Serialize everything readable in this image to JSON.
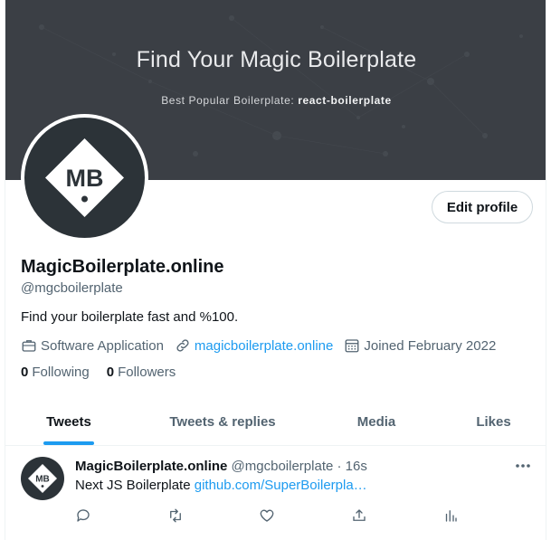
{
  "banner": {
    "title": "Find Your Magic Boilerplate",
    "subtitle_prefix": "Best Popular Boilerplate: ",
    "subtitle_bold": "react-boilerplate",
    "color": "#3b3f45"
  },
  "avatar": {
    "initials": "MB"
  },
  "profile": {
    "edit_label": "Edit profile",
    "name": "MagicBoilerplate.online",
    "handle": "@mgcboilerplate",
    "bio": "Find your boilerplate fast and %100.",
    "category": "Software Application",
    "website": "magicboilerplate.online",
    "joined": "Joined February 2022",
    "following_count": "0",
    "following_label": "Following",
    "followers_count": "0",
    "followers_label": "Followers"
  },
  "tabs": [
    {
      "label": "Tweets",
      "active": true
    },
    {
      "label": "Tweets & replies",
      "active": false
    },
    {
      "label": "Media",
      "active": false
    },
    {
      "label": "Likes",
      "active": false
    }
  ],
  "tweet": {
    "name": "MagicBoilerplate.online",
    "handle": "@mgcboilerplate",
    "separator": " · ",
    "time": "16s",
    "text": "Next JS Boilerplate ",
    "link": "github.com/SuperBoilerpla…",
    "more_icon": "more-icon",
    "actions": [
      "reply-icon",
      "retweet-icon",
      "like-icon",
      "share-icon",
      "analytics-icon"
    ]
  },
  "colors": {
    "accent": "#1d9bf0",
    "text": "#0f1419",
    "muted": "#536471"
  }
}
